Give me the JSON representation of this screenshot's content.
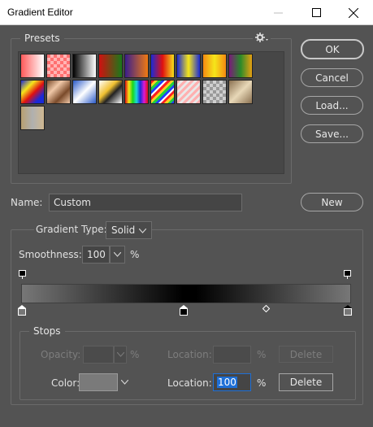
{
  "window": {
    "title": "Gradient Editor"
  },
  "presets": {
    "label": "Presets",
    "swatches": [
      {
        "name": "preset-swatch-1",
        "bg": "linear-gradient(to right,#ff5a5a,#ffffff)"
      },
      {
        "name": "preset-swatch-2",
        "bg": "repeating-conic-gradient(#ffb5b5 0 25%, #ff7070 0 50%) 0 0/8px 8px"
      },
      {
        "name": "preset-swatch-3",
        "bg": "linear-gradient(to right,#000,#fff)"
      },
      {
        "name": "preset-swatch-4",
        "bg": "linear-gradient(to right,#d01010,#1a7a1a)"
      },
      {
        "name": "preset-swatch-5",
        "bg": "linear-gradient(to right,#3a1e8c,#f07a12)"
      },
      {
        "name": "preset-swatch-6",
        "bg": "linear-gradient(to right,#1a2ad8,#e01010,#f5e01a)"
      },
      {
        "name": "preset-swatch-7",
        "bg": "linear-gradient(to right,#1a2ad8,#f5e61a,#1a2ad8)"
      },
      {
        "name": "preset-swatch-8",
        "bg": "linear-gradient(to right,#f58a12,#f5e61a,#f58a12)"
      },
      {
        "name": "preset-swatch-9",
        "bg": "linear-gradient(to right,#7a1a7a,#2a8a2a,#e6a012)"
      },
      {
        "name": "preset-swatch-10",
        "bg": "linear-gradient(135deg,#1a2ad8 0%,#f5e61a 30%,#e01010 55%,#1a2ad8 80%)"
      },
      {
        "name": "preset-swatch-11",
        "bg": "linear-gradient(135deg,#7a4a2a,#f0c8a8,#7a4a2a,#f0c8a8)"
      },
      {
        "name": "preset-swatch-12",
        "bg": "linear-gradient(135deg,#2a5ac8,#ffffff,#2a5ac8)"
      },
      {
        "name": "preset-swatch-13",
        "bg": "linear-gradient(135deg,#ffffff 0%,#f0c030 40%,#222 60%,#ffffff 100%)"
      },
      {
        "name": "preset-swatch-14",
        "bg": "linear-gradient(to right,#e01010,#f5e61a,#1ad81a,#1ad8d8,#1a2ad8,#d81ad8,#e01010)"
      },
      {
        "name": "preset-swatch-15",
        "bg": "repeating-linear-gradient(135deg,#ff2020 0 3px,#ffd020 3px 6px,#20d040 6px 9px,#2040ff 9px 12px,#ffffff 12px 14px)"
      },
      {
        "name": "preset-swatch-16",
        "bg": "repeating-linear-gradient(135deg,#ffb0b0 0 3px,#e8e8e8 3px 6px)"
      },
      {
        "name": "preset-swatch-17",
        "bg": "repeating-conic-gradient(#cfcfcf 0 25%, #9a9a9a 0 50%) 0 0/8px 8px"
      },
      {
        "name": "preset-swatch-18",
        "bg": "linear-gradient(135deg,#8a7050,#e8d8b8,#8a7050)"
      },
      {
        "name": "preset-swatch-19",
        "bg": "linear-gradient(to right,#b8a070,#b0b0b0,#d0b890)"
      }
    ]
  },
  "buttons": {
    "ok": "OK",
    "cancel": "Cancel",
    "load": "Load...",
    "save": "Save...",
    "new": "New"
  },
  "name_field": {
    "label": "Name:",
    "value": "Custom"
  },
  "gradient": {
    "type_label": "Gradient Type:",
    "type_value": "Solid",
    "smoothness_label": "Smoothness:",
    "smoothness_value": "100",
    "smoothness_unit": "%"
  },
  "stops": {
    "label": "Stops",
    "opacity_label": "Opacity:",
    "opacity_value": "",
    "opacity_unit": "%",
    "opacity_location_label": "Location:",
    "opacity_location_value": "",
    "opacity_location_unit": "%",
    "opacity_delete": "Delete",
    "color_label": "Color:",
    "color_swatch": "#7a7a7a",
    "color_location_label": "Location:",
    "color_location_value": "100",
    "color_location_unit": "%",
    "color_delete": "Delete"
  },
  "colors": {
    "dialog_bg": "#535353",
    "selected_text_bg": "#1e6fd6",
    "gradient_end": "#777777",
    "gradient_mid": "#000000"
  }
}
